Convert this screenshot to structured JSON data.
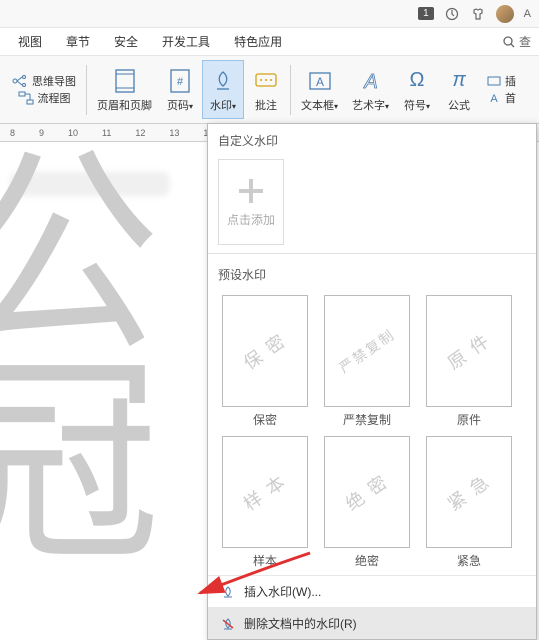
{
  "titlebar": {
    "badge": "1",
    "user_letter": "A"
  },
  "tabs": {
    "t1": "视图",
    "t2": "章节",
    "t3": "安全",
    "t4": "开发工具",
    "t5": "特色应用",
    "search": "查"
  },
  "ribbon": {
    "mindmap": "思维导图",
    "flowchart": "流程图",
    "header_footer": "页眉和页脚",
    "page_number": "页码",
    "watermark": "水印",
    "annotation": "批注",
    "textbox": "文本框",
    "wordart": "艺术字",
    "symbol": "符号",
    "formula": "公式",
    "insert": "插",
    "first": "首"
  },
  "ruler": {
    "r1": "8",
    "r2": "9",
    "r3": "10",
    "r4": "11",
    "r5": "12",
    "r6": "13",
    "r7": "1"
  },
  "dropdown": {
    "custom_title": "自定义水印",
    "add_label": "点击添加",
    "preset_title": "预设水印",
    "presets": [
      {
        "wm": "保 密",
        "label": "保密"
      },
      {
        "wm": "严禁复制",
        "label": "严禁复制"
      },
      {
        "wm": "原 件",
        "label": "原件"
      },
      {
        "wm": "样 本",
        "label": "样本"
      },
      {
        "wm": "绝 密",
        "label": "绝密"
      },
      {
        "wm": "紧 急",
        "label": "紧急"
      }
    ],
    "insert_wm": "插入水印(W)...",
    "remove_wm": "删除文档中的水印(R)"
  }
}
